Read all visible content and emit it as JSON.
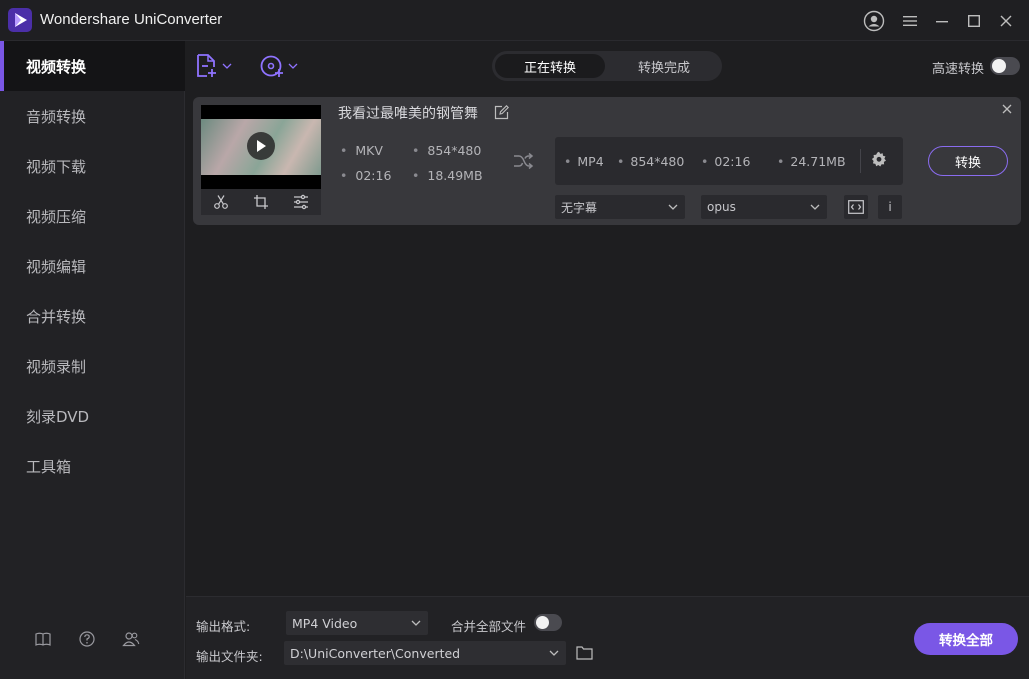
{
  "app": {
    "title": "Wondershare UniConverter",
    "accent_color": "#7a57e6"
  },
  "window_controls": {
    "icons": [
      "account-icon",
      "menu-icon",
      "minimize-icon",
      "maximize-icon",
      "close-icon"
    ]
  },
  "sidebar": {
    "items": [
      {
        "label": "视频转换",
        "active": true
      },
      {
        "label": "音频转换"
      },
      {
        "label": "视频下载"
      },
      {
        "label": "视频压缩"
      },
      {
        "label": "视频编辑"
      },
      {
        "label": "合并转换"
      },
      {
        "label": "视频录制"
      },
      {
        "label": "刻录DVD"
      },
      {
        "label": "工具箱"
      }
    ],
    "footer_icons": [
      "book-icon",
      "help-icon",
      "users-icon"
    ]
  },
  "toolbar": {
    "add_file_icon": "add-file-icon",
    "add_disc_icon": "add-disc-icon",
    "tabs": [
      "正在转换",
      "转换完成"
    ],
    "active_tab": 0,
    "turbo_label": "高速转换",
    "turbo_enabled": false
  },
  "task": {
    "title": "我看过最唯美的钢管舞",
    "source": {
      "format": "MKV",
      "resolution": "854*480",
      "duration": "02:16",
      "size": "18.49MB"
    },
    "target": {
      "format": "MP4",
      "resolution": "854*480",
      "duration": "02:16",
      "size": "24.71MB"
    },
    "subtitle": "无字幕",
    "audio": "opus",
    "convert_label": "转换",
    "info_label": "i"
  },
  "bottom": {
    "output_format_label": "输出格式:",
    "output_format_value": "MP4 Video",
    "merge_label": "合并全部文件",
    "merge_enabled": false,
    "output_folder_label": "输出文件夹:",
    "output_folder_value": "D:\\UniConverter\\Converted",
    "convert_all_label": "转换全部"
  }
}
